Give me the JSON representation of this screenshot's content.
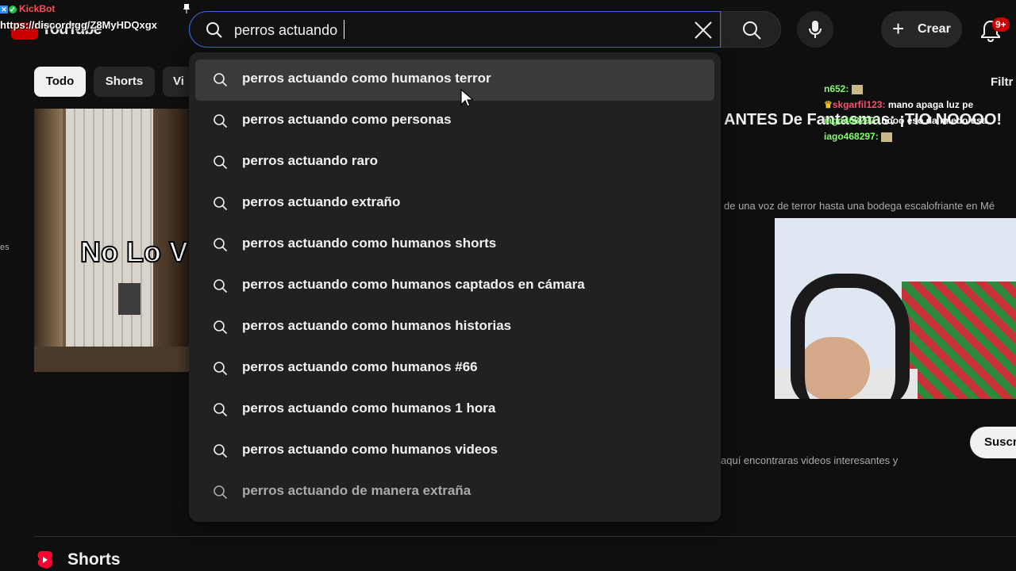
{
  "overlay": {
    "bot_name": "KickBot",
    "discord_link": "https://discord.gg/Z8MyHDQxgx"
  },
  "header": {
    "logo_text": "YouTube",
    "search_value": "perros actuando",
    "create_label": "Crear",
    "notification_count": "9+"
  },
  "chips": [
    {
      "label": "Todo",
      "active": true
    },
    {
      "label": "Shorts",
      "active": false
    },
    {
      "label": "Vi",
      "active": false
    }
  ],
  "suggestions": [
    "perros actuando como humanos terror",
    "perros actuando como personas",
    "perros actuando raro",
    "perros actuando extraño",
    "perros actuando como humanos shorts",
    "perros actuando como humanos captados en cámara",
    "perros actuando como humanos historias",
    "perros actuando como humanos #66",
    "perros actuando como humanos 1 hora",
    "perros actuando como humanos videos",
    "perros actuando de manera extraña"
  ],
  "background": {
    "thumbnail_text": "No Lo V",
    "side_text": "es",
    "video_title": "ANTES De Fantasmas: ¡TIO NOOOO!",
    "video_desc": "de una voz de terror hasta una bodega escalofriante en Mé",
    "channel_desc": "aquí encontraras videos interesantes y",
    "filters_label": "Filtr",
    "subscribe_label": "Suscr",
    "section_label": "Shorts"
  },
  "chat": [
    {
      "user": "n652:",
      "text": "",
      "user_color": "green"
    },
    {
      "user": "skgarfil123:",
      "text": "mano apaga luz pe",
      "user_color": "red"
    },
    {
      "user": "iago468297:",
      "text": "nooo eso da miedo usa",
      "user_color": "green"
    },
    {
      "user": "iago468297:",
      "text": "",
      "user_color": "green"
    }
  ],
  "colors": {
    "background": "#0f0f0f",
    "dropdown": "#212121",
    "focus_border": "#3d6ae0",
    "brand_red": "#cc0000"
  }
}
